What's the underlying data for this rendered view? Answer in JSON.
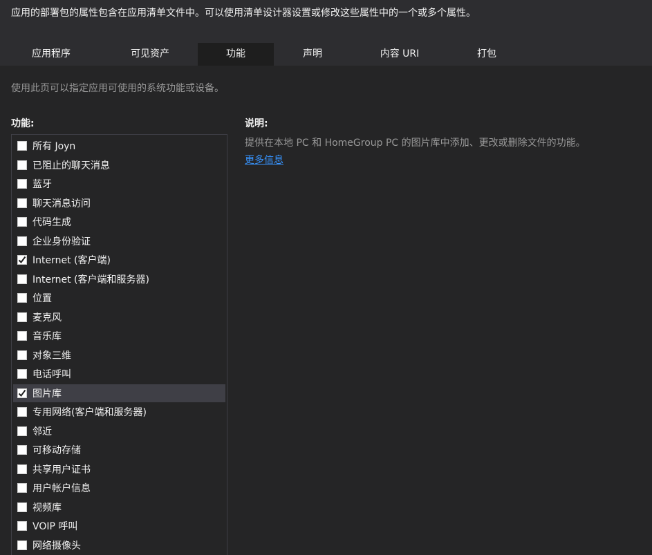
{
  "intro_text": "应用的部署包的属性包含在应用清单文件中。可以使用清单设计器设置或修改这些属性中的一个或多个属性。",
  "tabs": [
    {
      "label": "应用程序",
      "active": false
    },
    {
      "label": "可见资产",
      "active": false
    },
    {
      "label": "功能",
      "active": true
    },
    {
      "label": "声明",
      "active": false
    },
    {
      "label": "内容 URI",
      "active": false
    },
    {
      "label": "打包",
      "active": false
    }
  ],
  "page_description": "使用此页可以指定应用可使用的系统功能或设备。",
  "capabilities_header": "功能:",
  "capabilities": [
    {
      "label": "所有 Joyn",
      "checked": false
    },
    {
      "label": "已阻止的聊天消息",
      "checked": false
    },
    {
      "label": "蓝牙",
      "checked": false
    },
    {
      "label": "聊天消息访问",
      "checked": false
    },
    {
      "label": "代码生成",
      "checked": false
    },
    {
      "label": "企业身份验证",
      "checked": false
    },
    {
      "label": "Internet (客户端)",
      "checked": true
    },
    {
      "label": "Internet (客户端和服务器)",
      "checked": false
    },
    {
      "label": "位置",
      "checked": false
    },
    {
      "label": "麦克风",
      "checked": false
    },
    {
      "label": "音乐库",
      "checked": false
    },
    {
      "label": "对象三维",
      "checked": false
    },
    {
      "label": "电话呼叫",
      "checked": false
    },
    {
      "label": "图片库",
      "checked": true,
      "selected": true
    },
    {
      "label": "专用网络(客户端和服务器)",
      "checked": false
    },
    {
      "label": "邻近",
      "checked": false
    },
    {
      "label": "可移动存储",
      "checked": false
    },
    {
      "label": "共享用户证书",
      "checked": false
    },
    {
      "label": "用户帐户信息",
      "checked": false
    },
    {
      "label": "视频库",
      "checked": false
    },
    {
      "label": "VOIP 呼叫",
      "checked": false
    },
    {
      "label": "网络摄像头",
      "checked": false
    }
  ],
  "description_header": "说明:",
  "description_text": "提供在本地 PC 和 HomeGroup PC 的图片库中添加、更改或删除文件的功能。",
  "more_info_link": "更多信息",
  "colors": {
    "background": "#252526",
    "header_bg": "#2d2d30",
    "active_tab_bg": "#1e1e1e",
    "selected_row": "#3f3f46",
    "link": "#3794ff",
    "muted_text": "#999999"
  }
}
